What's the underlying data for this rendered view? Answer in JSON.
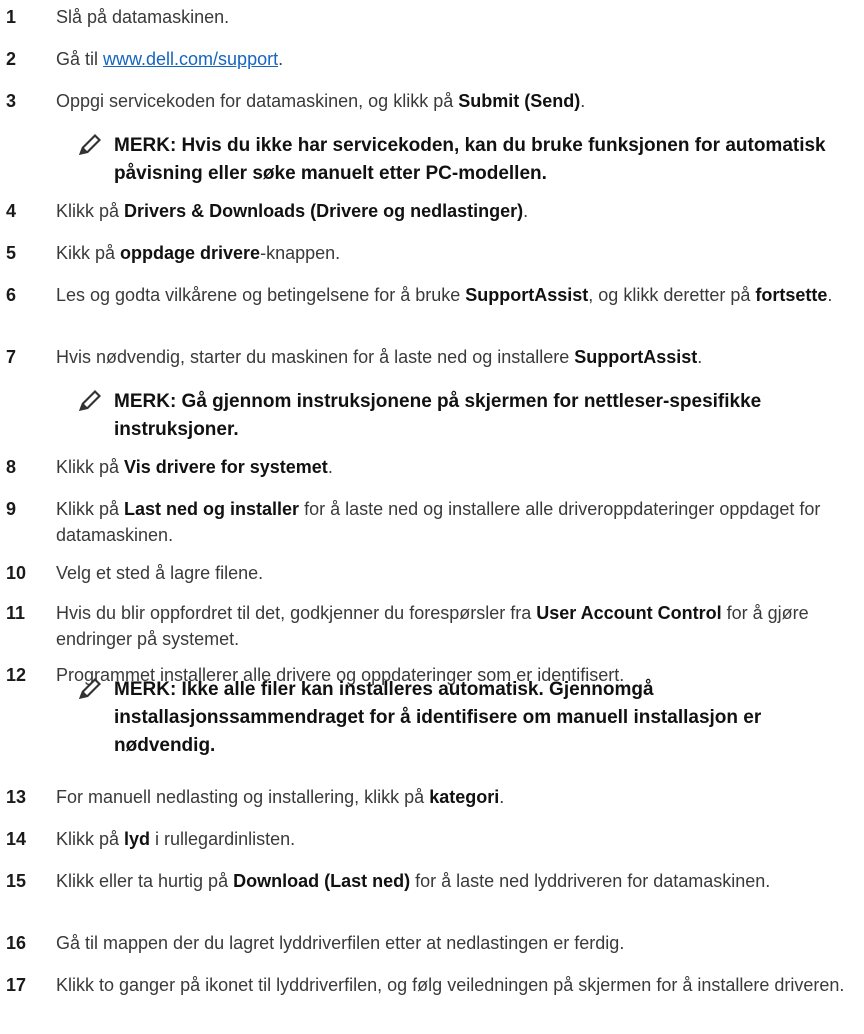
{
  "steps": [
    {
      "num": "1",
      "parts": [
        {
          "t": "Slå på datamaskinen."
        }
      ]
    },
    {
      "num": "2",
      "parts": [
        {
          "t": "Gå til "
        },
        {
          "t": "www.dell.com/support",
          "link": true
        },
        {
          "t": "."
        }
      ]
    },
    {
      "num": "3",
      "parts": [
        {
          "t": "Oppgi servicekoden for datamaskinen, og klikk på "
        },
        {
          "t": "Submit (Send)",
          "b": true
        },
        {
          "t": "."
        }
      ]
    },
    {
      "num": "4",
      "parts": [
        {
          "t": "Klikk på "
        },
        {
          "t": "Drivers & Downloads (Drivere og nedlastinger)",
          "b": true
        },
        {
          "t": "."
        }
      ]
    },
    {
      "num": "5",
      "parts": [
        {
          "t": "Kikk på "
        },
        {
          "t": "oppdage drivere",
          "b": true
        },
        {
          "t": "-knappen."
        }
      ]
    },
    {
      "num": "6",
      "parts": [
        {
          "t": "Les og godta vilkårene og betingelsene for å bruke "
        },
        {
          "t": "SupportAssist",
          "b": true
        },
        {
          "t": ", og klikk deretter på "
        },
        {
          "t": "fortsette",
          "b": true
        },
        {
          "t": "."
        }
      ]
    },
    {
      "num": "7",
      "parts": [
        {
          "t": "Hvis nødvendig, starter du maskinen for å laste ned og installere "
        },
        {
          "t": "SupportAssist",
          "b": true
        },
        {
          "t": "."
        }
      ]
    },
    {
      "num": "8",
      "parts": [
        {
          "t": "Klikk på "
        },
        {
          "t": "Vis drivere for systemet",
          "b": true
        },
        {
          "t": "."
        }
      ]
    },
    {
      "num": "9",
      "parts": [
        {
          "t": "Klikk på "
        },
        {
          "t": "Last ned og installer",
          "b": true
        },
        {
          "t": " for å laste ned og installere alle driveroppdateringer oppdaget for datamaskinen."
        }
      ]
    },
    {
      "num": "10",
      "parts": [
        {
          "t": "Velg et sted å lagre filene."
        }
      ]
    },
    {
      "num": "11",
      "parts": [
        {
          "t": "Hvis du blir oppfordret til det, godkjenner du forespørsler fra "
        },
        {
          "t": "User Account Control",
          "b": true
        },
        {
          "t": " for å gjøre endringer på systemet."
        }
      ]
    },
    {
      "num": "12",
      "parts": [
        {
          "t": "Programmet installerer alle drivere og oppdateringer som er identifisert."
        }
      ]
    },
    {
      "num": "13",
      "parts": [
        {
          "t": "For manuell nedlasting og installering, klikk på "
        },
        {
          "t": "kategori",
          "b": true
        },
        {
          "t": "."
        }
      ]
    },
    {
      "num": "14",
      "parts": [
        {
          "t": "Klikk på "
        },
        {
          "t": "lyd",
          "b": true
        },
        {
          "t": " i rullegardinlisten."
        }
      ]
    },
    {
      "num": "15",
      "parts": [
        {
          "t": "Klikk eller ta hurtig på "
        },
        {
          "t": "Download (Last ned)",
          "b": true
        },
        {
          "t": " for å laste ned lyddriveren for datamaskinen."
        }
      ]
    },
    {
      "num": "16",
      "parts": [
        {
          "t": "Gå til mappen der du lagret lyddriverfilen etter at nedlastingen er ferdig."
        }
      ]
    },
    {
      "num": "17",
      "parts": [
        {
          "t": "Klikk to ganger på ikonet til lyddriverfilen, og følg veiledningen på skjermen for å installere driveren."
        }
      ]
    }
  ],
  "notes": [
    {
      "text": "MERK: Hvis du ikke har servicekoden, kan du bruke funksjonen for automatisk påvisning eller søke manuelt etter PC-modellen."
    },
    {
      "text": "MERK: Gå gjennom instruksjonene på skjermen for nettleser-spesifikke instruksjoner."
    },
    {
      "text": "MERK: Ikke alle filer kan installeres automatisk. Gjennomgå installasjonssammendraget for å identifisere om manuell installasjon er nødvendig."
    }
  ]
}
